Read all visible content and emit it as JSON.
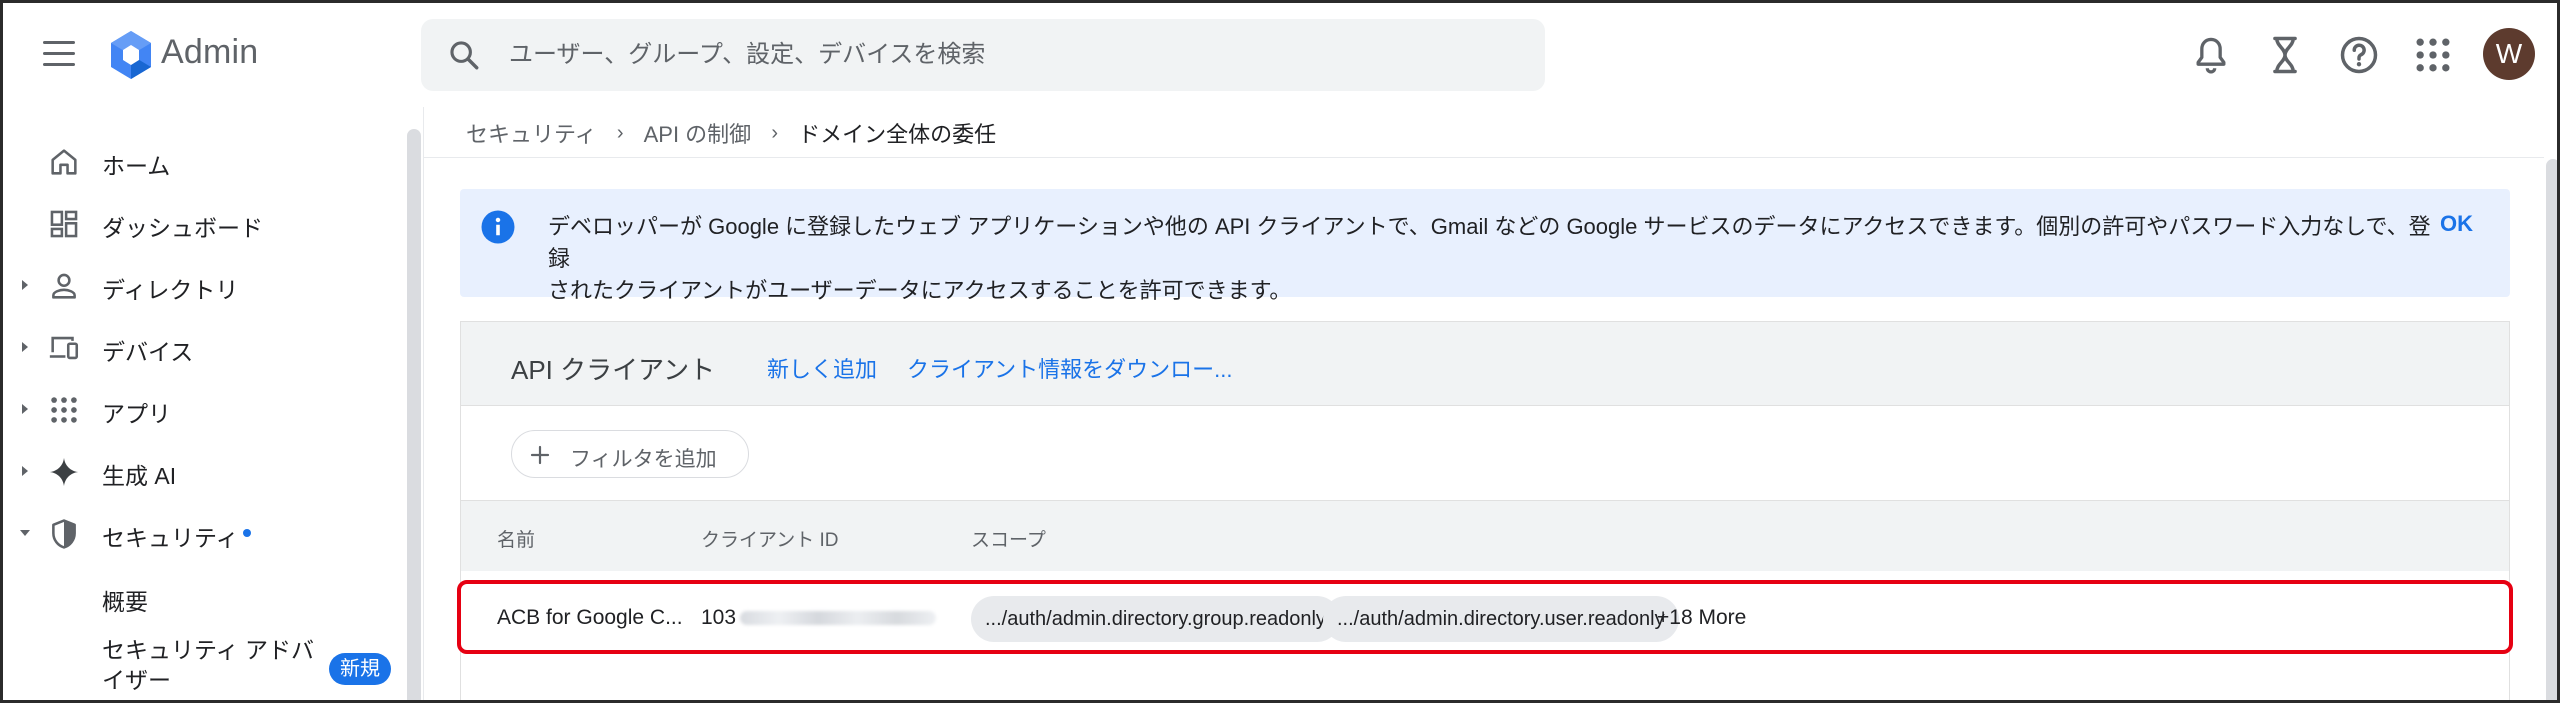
{
  "header": {
    "brand": "Admin",
    "search_placeholder": "ユーザー、グループ、設定、デバイスを検索",
    "avatar_initial": "W",
    "icons": [
      "bell-icon",
      "hourglass-icon",
      "help-icon",
      "apps-grid-icon"
    ]
  },
  "sidebar": {
    "items": [
      {
        "label": "ホーム",
        "icon": "home-icon"
      },
      {
        "label": "ダッシュボード",
        "icon": "dashboard-icon"
      },
      {
        "label": "ディレクトリ",
        "icon": "person-icon"
      },
      {
        "label": "デバイス",
        "icon": "devices-icon"
      },
      {
        "label": "アプリ",
        "icon": "apps-icon"
      },
      {
        "label": "生成 AI",
        "icon": "sparkle-icon"
      },
      {
        "label": "セキュリティ",
        "icon": "shield-icon"
      }
    ],
    "subitems": [
      {
        "label": "概要"
      },
      {
        "label_line1": "セキュリティ アドバ",
        "label_line2": "イザー",
        "badge": "新規"
      }
    ]
  },
  "breadcrumb": {
    "items": [
      "セキュリティ",
      "API の制御"
    ],
    "current": "ドメイン全体の委任"
  },
  "info": {
    "line1": "デベロッパーが Google に登録したウェブ アプリケーションや他の API クライアントで、Gmail などの Google サービスのデータにアクセスできます。個別の許可やパスワード入力なしで、登録",
    "line2": "されたクライアントがユーザーデータにアクセスすることを許可できます。",
    "ok": "OK"
  },
  "card": {
    "title": "API クライアント",
    "add_new": "新しく追加",
    "download": "クライアント情報をダウンロー...",
    "filter_label": "フィルタを追加",
    "columns": [
      "名前",
      "クライアント ID",
      "スコープ"
    ],
    "rows": [
      {
        "name": "ACB for Google C...",
        "client_id_prefix": "103",
        "scopes": [
          ".../auth/admin.directory.group.readonly",
          ".../auth/admin.directory.user.readonly"
        ],
        "more": "+18 More"
      }
    ]
  },
  "colors": {
    "accent": "#1a73e8",
    "highlight": "#e60012",
    "info_bg": "#e8f0fe",
    "avatar_bg": "#5d3b2e"
  }
}
